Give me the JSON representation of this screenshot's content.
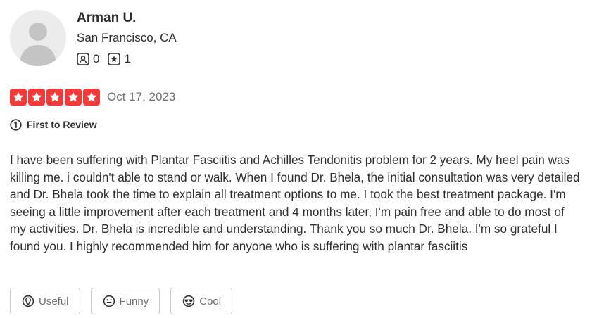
{
  "reviewer": {
    "name": "Arman U.",
    "location": "San Francisco, CA",
    "stats": [
      {
        "icon": "friends-icon",
        "value": "0"
      },
      {
        "icon": "review-count-icon",
        "value": "1"
      }
    ]
  },
  "review": {
    "rating": 5,
    "rating_max": 5,
    "date": "Oct 17, 2023",
    "badge": {
      "icon": "first-review-icon",
      "label": "First to Review"
    },
    "text": "I have been suffering with Plantar Fasciitis and Achilles Tendonitis problem for 2 years. My heel pain was killing me. i couldn't able to stand or walk. When I found Dr. Bhela, the initial consultation was very detailed and Dr. Bhela took the time to explain all treatment options to me. I took the best treatment package. I'm seeing a little improvement after each treatment and 4 months later, I'm pain free and able to do most of my activities. Dr. Bhela is incredible and understanding. Thank you so much Dr. Bhela. I'm so grateful I found you. I highly recommended him for anyone who is suffering with plantar fasciitis"
  },
  "actions": [
    {
      "icon": "lightbulb-icon",
      "label": "Useful"
    },
    {
      "icon": "smile-icon",
      "label": "Funny"
    },
    {
      "icon": "sunglasses-icon",
      "label": "Cool"
    }
  ],
  "colors": {
    "star": "#f43939",
    "text": "#2d2e2f",
    "muted": "#6e7072",
    "border": "#c8c9ca"
  }
}
